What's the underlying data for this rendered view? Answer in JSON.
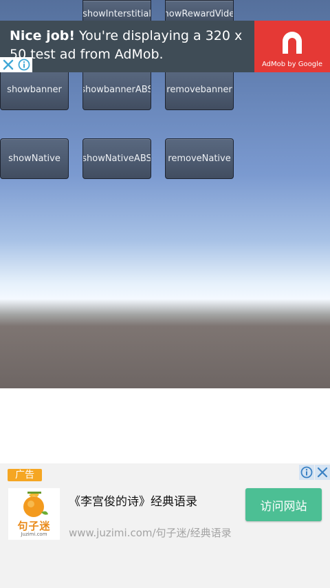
{
  "buttons": {
    "row1": [
      "showInterstitial",
      "showRewardVideo"
    ],
    "row2": [
      "showbanner",
      "showbannerABS",
      "removebanner"
    ],
    "row3": [
      "showNative",
      "showNativeABS",
      "removeNative"
    ]
  },
  "top_ad": {
    "headline": "Nice job!",
    "body": " You're displaying a 320 x 50 test ad from AdMob.",
    "logo_caption": "AdMob by Google",
    "close_icon": "close-icon",
    "info_icon": "info-icon",
    "logo_color": "#e53935"
  },
  "native_ad": {
    "badge": "广告",
    "logo_name": "句子迷",
    "logo_url": "Juzimi.com",
    "title": "《李宫俊的诗》经典语录",
    "url": "www.juzimi.com/句子迷/经典语录",
    "cta": "访问网站",
    "cta_color": "#4cbf94",
    "badge_color": "#f5a623"
  }
}
